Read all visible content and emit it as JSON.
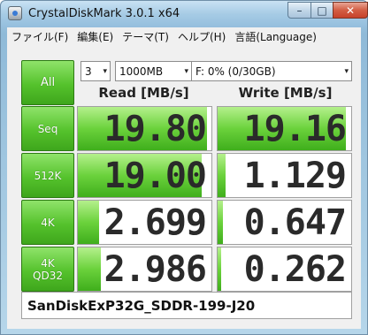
{
  "window": {
    "title": "CrystalDiskMark 3.0.1 x64",
    "controls": {
      "minimize": "–",
      "maximize": "□",
      "close": "✕"
    }
  },
  "menu": [
    "ファイル(F)",
    "編集(E)",
    "テーマ(T)",
    "ヘルプ(H)",
    "言語(Language)"
  ],
  "controls": {
    "all_label": "All",
    "test_count": "3",
    "test_size": "1000MB",
    "drive": "F: 0% (0/30GB)",
    "dropdown_arrow": "▾"
  },
  "columns": {
    "read": "Read [MB/s]",
    "write": "Write [MB/s]"
  },
  "rows": [
    {
      "label_line1": "Seq",
      "label_line2": "",
      "read": "19.80",
      "write": "19.16",
      "read_fill": 0.97,
      "write_fill": 0.96
    },
    {
      "label_line1": "512K",
      "label_line2": "",
      "read": "19.00",
      "write": "1.129",
      "read_fill": 0.93,
      "write_fill": 0.06
    },
    {
      "label_line1": "4K",
      "label_line2": "",
      "read": "2.699",
      "write": "0.647",
      "read_fill": 0.16,
      "write_fill": 0.04
    },
    {
      "label_line1": "4K",
      "label_line2": "QD32",
      "read": "2.986",
      "write": "0.262",
      "read_fill": 0.17,
      "write_fill": 0.02
    }
  ],
  "comment": "SanDiskExP32G_SDDR-199-J20",
  "colors": {
    "accent_green": "#55c22c",
    "bar_green": "#6bd23c",
    "close_red": "#c7422a"
  }
}
